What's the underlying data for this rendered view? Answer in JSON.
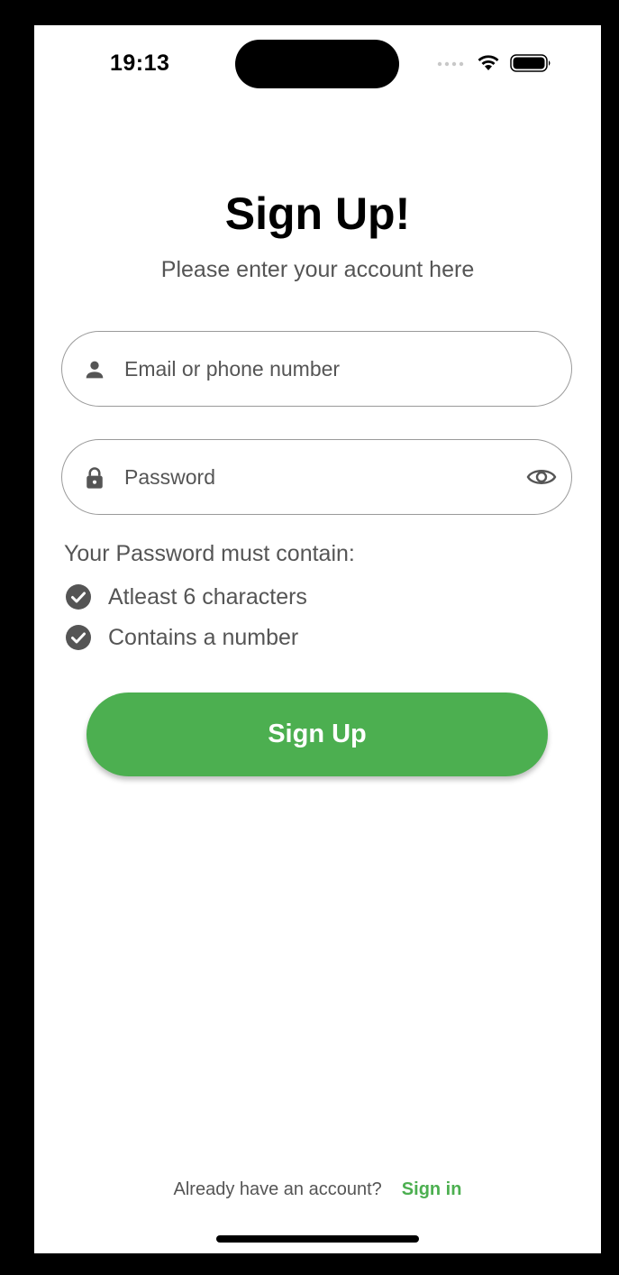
{
  "status_bar": {
    "time": "19:13"
  },
  "header": {
    "title": "Sign Up!",
    "subtitle": "Please enter your account here"
  },
  "form": {
    "email": {
      "placeholder": "Email or phone number",
      "value": "",
      "icon": "person-icon"
    },
    "password": {
      "placeholder": "Password",
      "value": "",
      "icon": "lock-icon",
      "toggle_icon": "eye-icon"
    }
  },
  "requirements": {
    "heading": "Your Password must contain:",
    "items": [
      {
        "label": "Atleast 6 characters",
        "met": true
      },
      {
        "label": "Contains a number",
        "met": true
      }
    ]
  },
  "actions": {
    "signup_label": "Sign Up"
  },
  "footer": {
    "prompt": "Already have an account?",
    "signin_label": "Sign in"
  },
  "colors": {
    "accent": "#4caf50",
    "text_secondary": "#555555",
    "border": "#9a9a9a"
  }
}
